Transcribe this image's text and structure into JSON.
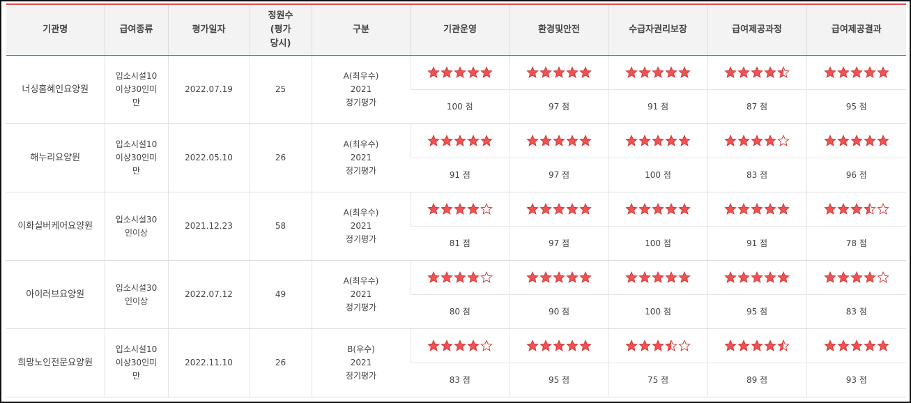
{
  "colors": {
    "accent": "#e04a4a",
    "star_fill": "#ee5252",
    "star_stroke": "#d23c3c",
    "header_bg": "#f3f3f3"
  },
  "headers": [
    "기관명",
    "급여종류",
    "평가일자",
    "정원수\n(평가\n당시)",
    "구분",
    "기관운영",
    "환경및안전",
    "수급자권리보장",
    "급여제공과정",
    "급여제공결과"
  ],
  "rows": [
    {
      "name": "너싱홈혜인요양원",
      "type_lines": [
        "입소시설10",
        "이상30인미",
        "만"
      ],
      "date": "2022.07.19",
      "capacity": "25",
      "grade_lines": [
        "A(최우수)",
        "2021",
        "정기평가"
      ],
      "metrics": [
        {
          "stars": 5,
          "score": "100 점"
        },
        {
          "stars": 5,
          "score": "97 점"
        },
        {
          "stars": 5,
          "score": "91 점"
        },
        {
          "stars": 4.5,
          "score": "87 점"
        },
        {
          "stars": 5,
          "score": "95 점"
        }
      ]
    },
    {
      "name": "해누리요양원",
      "type_lines": [
        "입소시설10",
        "이상30인미",
        "만"
      ],
      "date": "2022.05.10",
      "capacity": "26",
      "grade_lines": [
        "A(최우수)",
        "2021",
        "정기평가"
      ],
      "metrics": [
        {
          "stars": 5,
          "score": "91 점"
        },
        {
          "stars": 5,
          "score": "97 점"
        },
        {
          "stars": 5,
          "score": "100 점"
        },
        {
          "stars": 4,
          "score": "83 점"
        },
        {
          "stars": 5,
          "score": "96 점"
        }
      ]
    },
    {
      "name": "이화실버케어요양원",
      "type_lines": [
        "입소시설30",
        "인이상"
      ],
      "date": "2021.12.23",
      "capacity": "58",
      "grade_lines": [
        "A(최우수)",
        "2021",
        "정기평가"
      ],
      "metrics": [
        {
          "stars": 4,
          "score": "81 점"
        },
        {
          "stars": 5,
          "score": "97 점"
        },
        {
          "stars": 5,
          "score": "100 점"
        },
        {
          "stars": 5,
          "score": "91 점"
        },
        {
          "stars": 3.5,
          "score": "78 점"
        }
      ]
    },
    {
      "name": "아이러브요양원",
      "type_lines": [
        "입소시설30",
        "인이상"
      ],
      "date": "2022.07.12",
      "capacity": "49",
      "grade_lines": [
        "A(최우수)",
        "2021",
        "정기평가"
      ],
      "metrics": [
        {
          "stars": 4,
          "score": "80 점"
        },
        {
          "stars": 5,
          "score": "90 점"
        },
        {
          "stars": 5,
          "score": "100 점"
        },
        {
          "stars": 5,
          "score": "95 점"
        },
        {
          "stars": 4,
          "score": "83 점"
        }
      ]
    },
    {
      "name": "희망노인전문요양원",
      "type_lines": [
        "입소시설10",
        "이상30인미",
        "만"
      ],
      "date": "2022.11.10",
      "capacity": "26",
      "grade_lines": [
        "B(우수)",
        "2021",
        "정기평가"
      ],
      "metrics": [
        {
          "stars": 4,
          "score": "83 점"
        },
        {
          "stars": 5,
          "score": "95 점"
        },
        {
          "stars": 3.5,
          "score": "75 점"
        },
        {
          "stars": 4.5,
          "score": "89 점"
        },
        {
          "stars": 5,
          "score": "93 점"
        }
      ]
    }
  ]
}
